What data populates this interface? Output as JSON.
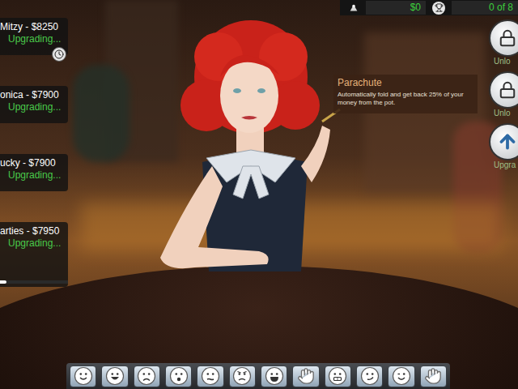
{
  "top_bar": {
    "money": "$0",
    "achievements": "0 of 8"
  },
  "players": [
    {
      "name": "Mitzy - $8250",
      "status": "Upgrading...",
      "timer": true
    },
    {
      "name": "onica - $7900",
      "status": "Upgrading...",
      "timer": false
    },
    {
      "name": "ucky - $7900",
      "status": "Upgrading...",
      "timer": false
    },
    {
      "name": "arties - $7950",
      "status": "Upgrading...",
      "timer": false,
      "level": 0.1
    }
  ],
  "tooltip": {
    "title": "Parachute",
    "text": "Automatically fold and get back 25% of your money from the pot."
  },
  "side_buttons": [
    {
      "label": "Unlo",
      "locked": true
    },
    {
      "label": "Unlo",
      "locked": true
    },
    {
      "label": "Upgra",
      "locked": false
    }
  ],
  "emotes": [
    {
      "kind": "smile"
    },
    {
      "kind": "happy"
    },
    {
      "kind": "sad"
    },
    {
      "kind": "shock"
    },
    {
      "kind": "worried"
    },
    {
      "kind": "angry"
    },
    {
      "kind": "laugh"
    },
    {
      "kind": "wave"
    },
    {
      "kind": "grin"
    },
    {
      "kind": "smirk"
    },
    {
      "kind": "wink"
    },
    {
      "kind": "cheer"
    }
  ]
}
